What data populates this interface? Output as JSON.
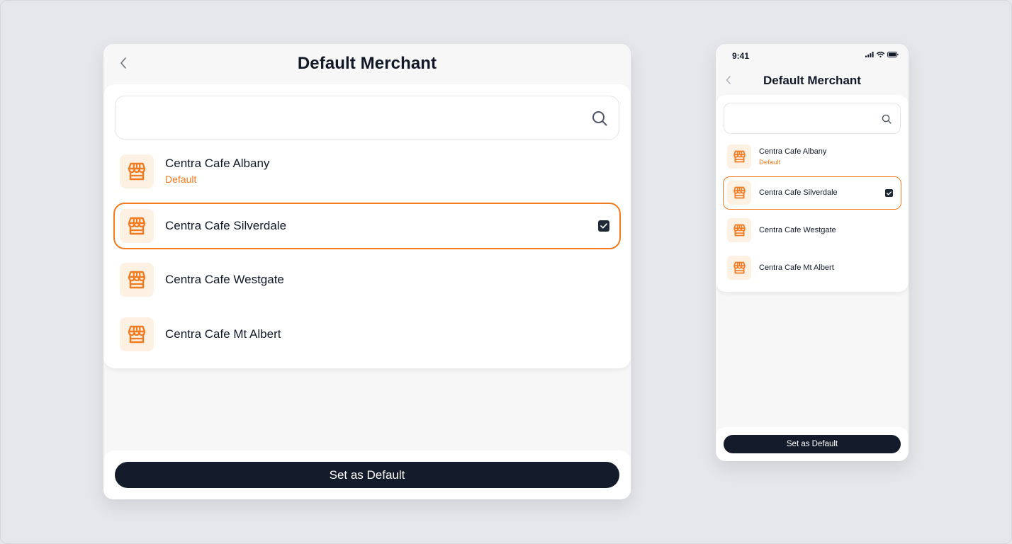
{
  "colors": {
    "accent": "#f47a1f",
    "button_bg": "#141b2a",
    "icon_tile_bg": "#fdf1e4",
    "page_bg": "#e5e7eb"
  },
  "tablet": {
    "title": "Default Merchant",
    "back_icon": "chevron-left-icon",
    "search": {
      "value": "",
      "placeholder": "",
      "icon": "search-icon"
    },
    "merchants": [
      {
        "name": "Centra Cafe Albany",
        "sublabel": "Default",
        "icon": "store-icon",
        "selected": false
      },
      {
        "name": "Centra Cafe Silverdale",
        "sublabel": "",
        "icon": "store-icon",
        "selected": true,
        "checked": true
      },
      {
        "name": "Centra Cafe Westgate",
        "sublabel": "",
        "icon": "store-icon",
        "selected": false
      },
      {
        "name": "Centra Cafe Mt Albert",
        "sublabel": "",
        "icon": "store-icon",
        "selected": false
      }
    ],
    "primary_button": "Set as Default"
  },
  "phone": {
    "status_time": "9:41",
    "status_icons": [
      "signal-icon",
      "wifi-icon",
      "battery-icon"
    ],
    "title": "Default Merchant",
    "back_icon": "chevron-left-icon",
    "search": {
      "value": "",
      "placeholder": "",
      "icon": "search-icon"
    },
    "merchants": [
      {
        "name": "Centra Cafe Albany",
        "sublabel": "Default",
        "icon": "store-icon",
        "selected": false
      },
      {
        "name": "Centra Cafe Silverdale",
        "sublabel": "",
        "icon": "store-icon",
        "selected": true,
        "checked": true
      },
      {
        "name": "Centra Cafe Westgate",
        "sublabel": "",
        "icon": "store-icon",
        "selected": false
      },
      {
        "name": "Centra Cafe Mt Albert",
        "sublabel": "",
        "icon": "store-icon",
        "selected": false
      }
    ],
    "primary_button": "Set as Default"
  }
}
